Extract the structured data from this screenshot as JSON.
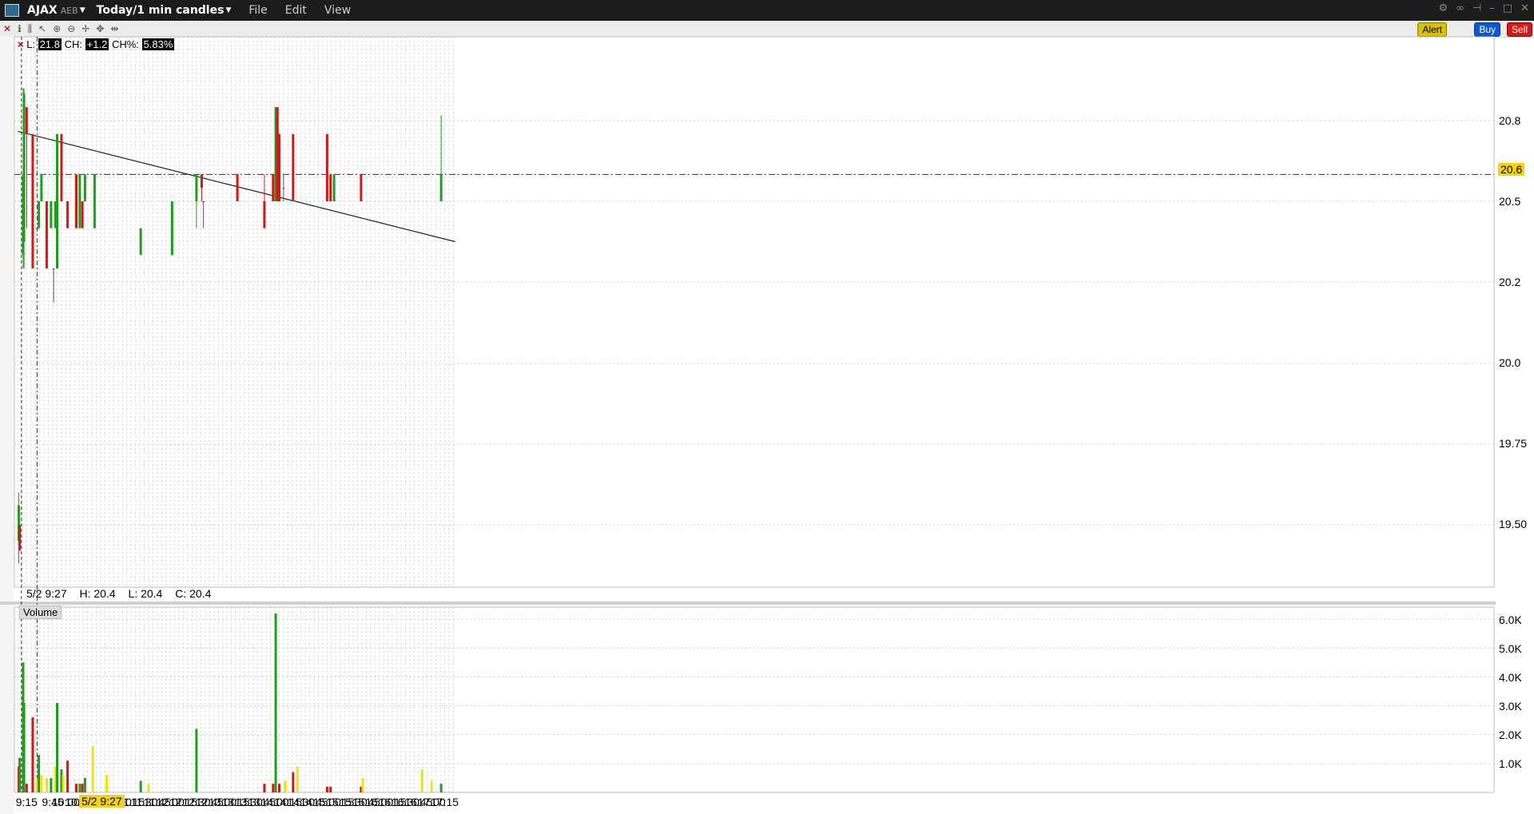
{
  "window": {
    "symbol": "AJAX",
    "exchange": "AEB",
    "period": "Today/1 min candles",
    "menus": [
      "File",
      "Edit",
      "View"
    ]
  },
  "toolbar": {
    "alert_label": "Alert",
    "buy_label": "Buy",
    "sell_label": "Sell"
  },
  "quote_strip": {
    "l_label": "L:",
    "l_value": "21.8",
    "ch_label": "CH:",
    "ch_value": "+1.2",
    "chp_label": "CH%:",
    "chp_value": "5.83%"
  },
  "cursor_info": {
    "date": "5/2 9:27",
    "high": "H: 20.4",
    "low": "L: 20.4",
    "close": "C: 20.4"
  },
  "volume_label": "Volume",
  "price_axis": {
    "ticks": [
      "20.8",
      "20.5",
      "20.2",
      "20.0",
      "19.75",
      "19.50"
    ],
    "last_price": "20.6"
  },
  "volume_axis": {
    "ticks": [
      "6.0K",
      "5.0K",
      "4.0K",
      "3.0K",
      "2.0K",
      "1.0K"
    ]
  },
  "time_axis": {
    "ticks": [
      "9:15",
      "9:45",
      "10:00",
      "10:15",
      "10:30",
      "10:45",
      "11:00",
      "11:15",
      "11:30",
      "11:45",
      "12:00",
      "12:15",
      "12:30",
      "12:45",
      "13:00",
      "13:15",
      "13:30",
      "13:45",
      "14:00",
      "14:15",
      "14:30",
      "14:45",
      "15:00",
      "15:15",
      "15:30",
      "15:45",
      "16:00",
      "16:15",
      "16:30",
      "16:45",
      "17:00",
      "17:15"
    ],
    "cursor_label": "5/2 9:27"
  },
  "colors": {
    "up": "#1e9e1e",
    "down": "#d01818",
    "neutral": "#555555",
    "volume_flat": "#f2e200",
    "highlight": "#f1d21c"
  },
  "chart_data": [
    {
      "type": "candlestick",
      "title": "",
      "xlabel": "",
      "ylabel": "",
      "ylim": [
        19.4,
        20.95
      ],
      "grid": true,
      "candles": [
        {
          "t": "9:06",
          "o": 19.45,
          "h": 19.6,
          "l": 19.38,
          "c": 19.56
        },
        {
          "t": "9:07",
          "o": 19.5,
          "h": 19.5,
          "l": 19.42,
          "c": 19.42
        },
        {
          "t": "9:11",
          "o": 20.3,
          "h": 20.92,
          "l": 20.25,
          "c": 20.6
        },
        {
          "t": "9:12",
          "o": 20.35,
          "h": 20.92,
          "l": 20.25,
          "c": 20.9
        },
        {
          "t": "9:15",
          "o": 20.85,
          "h": 20.85,
          "l": 20.4,
          "c": 20.75
        },
        {
          "t": "9:22",
          "o": 20.75,
          "h": 20.75,
          "l": 20.25,
          "c": 20.25
        },
        {
          "t": "9:27",
          "o": 20.4,
          "h": 20.4,
          "l": 20.4,
          "c": 20.4
        },
        {
          "t": "9:29",
          "o": 20.4,
          "h": 20.5,
          "l": 20.4,
          "c": 20.5
        },
        {
          "t": "9:32",
          "o": 20.5,
          "h": 20.6,
          "l": 20.5,
          "c": 20.6
        },
        {
          "t": "9:38",
          "o": 20.5,
          "h": 20.5,
          "l": 20.25,
          "c": 20.25
        },
        {
          "t": "9:43",
          "o": 20.4,
          "h": 20.5,
          "l": 20.4,
          "c": 20.5
        },
        {
          "t": "9:46",
          "o": 20.25,
          "h": 20.25,
          "l": 20.15,
          "c": 20.25
        },
        {
          "t": "9:48",
          "o": 20.4,
          "h": 20.5,
          "l": 20.4,
          "c": 20.5
        },
        {
          "t": "9:50",
          "o": 20.25,
          "h": 20.75,
          "l": 20.25,
          "c": 20.75
        },
        {
          "t": "9:55",
          "o": 20.75,
          "h": 20.75,
          "l": 20.5,
          "c": 20.5
        },
        {
          "t": "10:02",
          "o": 20.5,
          "h": 20.5,
          "l": 20.4,
          "c": 20.4
        },
        {
          "t": "10:12",
          "o": 20.6,
          "h": 20.6,
          "l": 20.4,
          "c": 20.4
        },
        {
          "t": "10:16",
          "o": 20.4,
          "h": 20.6,
          "l": 20.4,
          "c": 20.6
        },
        {
          "t": "10:19",
          "o": 20.5,
          "h": 20.5,
          "l": 20.4,
          "c": 20.4
        },
        {
          "t": "10:22",
          "o": 20.5,
          "h": 20.6,
          "l": 20.5,
          "c": 20.6
        },
        {
          "t": "10:33",
          "o": 20.4,
          "h": 20.6,
          "l": 20.4,
          "c": 20.6
        },
        {
          "t": "11:26",
          "o": 20.3,
          "h": 20.4,
          "l": 20.3,
          "c": 20.4
        },
        {
          "t": "12:02",
          "o": 20.3,
          "h": 20.5,
          "l": 20.3,
          "c": 20.5
        },
        {
          "t": "12:30",
          "o": 20.5,
          "h": 20.6,
          "l": 20.4,
          "c": 20.6
        },
        {
          "t": "12:36",
          "o": 20.6,
          "h": 20.6,
          "l": 20.5,
          "c": 20.55
        },
        {
          "t": "12:38",
          "o": 20.5,
          "h": 20.5,
          "l": 20.4,
          "c": 20.5
        },
        {
          "t": "13:17",
          "o": 20.6,
          "h": 20.6,
          "l": 20.5,
          "c": 20.5
        },
        {
          "t": "13:48",
          "o": 20.5,
          "h": 20.6,
          "l": 20.4,
          "c": 20.4
        },
        {
          "t": "13:58",
          "o": 20.6,
          "h": 20.6,
          "l": 20.5,
          "c": 20.5
        },
        {
          "t": "14:01",
          "o": 20.5,
          "h": 20.85,
          "l": 20.5,
          "c": 20.85
        },
        {
          "t": "14:03",
          "o": 20.85,
          "h": 20.85,
          "l": 20.5,
          "c": 20.5
        },
        {
          "t": "14:05",
          "o": 20.75,
          "h": 20.75,
          "l": 20.5,
          "c": 20.5
        },
        {
          "t": "14:10",
          "o": 20.55,
          "h": 20.6,
          "l": 20.5,
          "c": 20.55
        },
        {
          "t": "14:21",
          "o": 20.75,
          "h": 20.75,
          "l": 20.5,
          "c": 20.5
        },
        {
          "t": "15:00",
          "o": 20.75,
          "h": 20.75,
          "l": 20.5,
          "c": 20.5
        },
        {
          "t": "15:04",
          "o": 20.6,
          "h": 20.6,
          "l": 20.5,
          "c": 20.5
        },
        {
          "t": "15:08",
          "o": 20.5,
          "h": 20.6,
          "l": 20.5,
          "c": 20.6
        },
        {
          "t": "15:39",
          "o": 20.6,
          "h": 20.6,
          "l": 20.5,
          "c": 20.5
        },
        {
          "t": "17:11",
          "o": 20.5,
          "h": 20.82,
          "l": 20.5,
          "c": 20.6
        }
      ],
      "trendline": {
        "from": {
          "t": "9:05",
          "y": 20.76
        },
        "to": {
          "t": "17:27",
          "y": 20.35
        }
      },
      "horizontal_line": 20.6
    },
    {
      "type": "bar",
      "title": "Volume",
      "ylim": [
        0,
        6500
      ],
      "bars": [
        {
          "t": "9:06",
          "v": 900,
          "dir": "down"
        },
        {
          "t": "9:07",
          "v": 1200,
          "dir": "up"
        },
        {
          "t": "9:11",
          "v": 4500,
          "dir": "up"
        },
        {
          "t": "9:12",
          "v": 3100,
          "dir": "up"
        },
        {
          "t": "9:15",
          "v": 300,
          "dir": "down"
        },
        {
          "t": "9:22",
          "v": 2600,
          "dir": "down"
        },
        {
          "t": "9:27",
          "v": 500,
          "dir": "flat"
        },
        {
          "t": "9:29",
          "v": 1300,
          "dir": "up"
        },
        {
          "t": "9:32",
          "v": 600,
          "dir": "flat"
        },
        {
          "t": "9:38",
          "v": 500,
          "dir": "flat"
        },
        {
          "t": "9:43",
          "v": 500,
          "dir": "up"
        },
        {
          "t": "9:48",
          "v": 900,
          "dir": "flat"
        },
        {
          "t": "9:50",
          "v": 3100,
          "dir": "up"
        },
        {
          "t": "9:55",
          "v": 800,
          "dir": "up"
        },
        {
          "t": "9:57",
          "v": 600,
          "dir": "flat"
        },
        {
          "t": "10:02",
          "v": 1100,
          "dir": "down"
        },
        {
          "t": "10:12",
          "v": 300,
          "dir": "down"
        },
        {
          "t": "10:16",
          "v": 300,
          "dir": "up"
        },
        {
          "t": "10:19",
          "v": 300,
          "dir": "down"
        },
        {
          "t": "10:22",
          "v": 500,
          "dir": "up"
        },
        {
          "t": "10:31",
          "v": 1600,
          "dir": "flat"
        },
        {
          "t": "10:47",
          "v": 600,
          "dir": "flat"
        },
        {
          "t": "11:26",
          "v": 400,
          "dir": "up"
        },
        {
          "t": "11:35",
          "v": 300,
          "dir": "flat"
        },
        {
          "t": "12:30",
          "v": 2200,
          "dir": "up"
        },
        {
          "t": "13:48",
          "v": 300,
          "dir": "down"
        },
        {
          "t": "13:58",
          "v": 300,
          "dir": "down"
        },
        {
          "t": "14:01",
          "v": 6200,
          "dir": "up"
        },
        {
          "t": "14:05",
          "v": 300,
          "dir": "down"
        },
        {
          "t": "14:12",
          "v": 400,
          "dir": "flat"
        },
        {
          "t": "14:21",
          "v": 700,
          "dir": "down"
        },
        {
          "t": "14:26",
          "v": 900,
          "dir": "flat"
        },
        {
          "t": "15:00",
          "v": 200,
          "dir": "down"
        },
        {
          "t": "15:04",
          "v": 200,
          "dir": "down"
        },
        {
          "t": "15:39",
          "v": 200,
          "dir": "down"
        },
        {
          "t": "15:41",
          "v": 500,
          "dir": "flat"
        },
        {
          "t": "16:49",
          "v": 800,
          "dir": "flat"
        },
        {
          "t": "17:00",
          "v": 400,
          "dir": "flat"
        },
        {
          "t": "17:11",
          "v": 300,
          "dir": "up"
        }
      ]
    }
  ]
}
